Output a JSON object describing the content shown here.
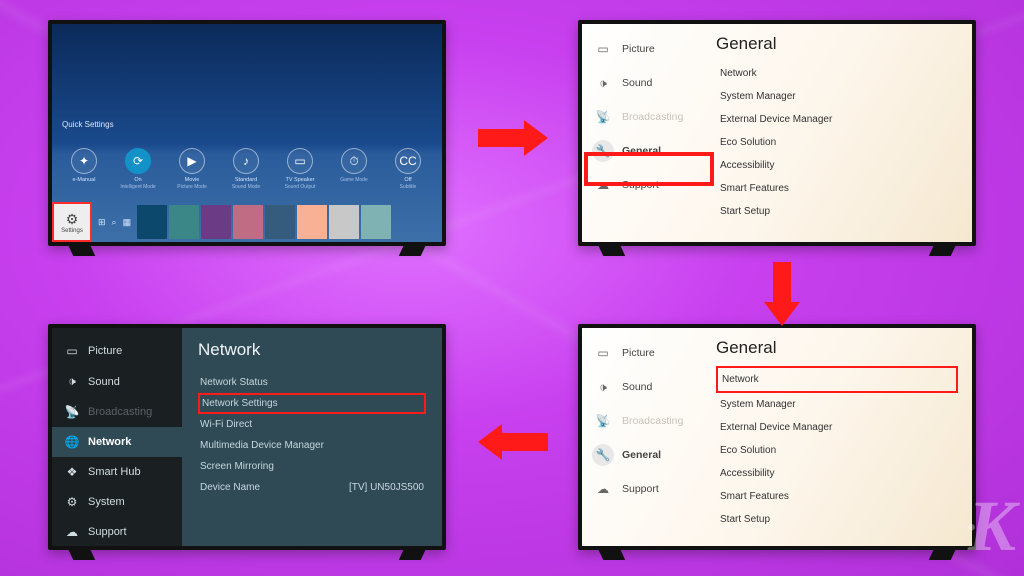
{
  "tv1": {
    "quickSettingsLabel": "Quick Settings",
    "items": [
      {
        "icon": "✦",
        "label": "e-Manual",
        "sub": ""
      },
      {
        "icon": "⟳",
        "label": "On",
        "sub": "Intelligent Mode",
        "hi": true
      },
      {
        "icon": "▶",
        "label": "Movie",
        "sub": "Picture Mode"
      },
      {
        "icon": "♪",
        "label": "Standard",
        "sub": "Sound Mode"
      },
      {
        "icon": "▭",
        "label": "TV Speaker",
        "sub": "Sound Output"
      },
      {
        "icon": "⏱",
        "label": "",
        "sub": "Game Mode"
      },
      {
        "icon": "CC",
        "label": "Off",
        "sub": "Subtitle"
      }
    ],
    "settingsTile": "Settings"
  },
  "sideCategories": [
    {
      "key": "picture",
      "label": "Picture",
      "icon": "▭"
    },
    {
      "key": "sound",
      "label": "Sound",
      "icon": "🕩"
    },
    {
      "key": "broadcasting",
      "label": "Broadcasting",
      "icon": "📡",
      "muted": true
    },
    {
      "key": "general",
      "label": "General",
      "icon": "🔧"
    },
    {
      "key": "support",
      "label": "Support",
      "icon": "☁"
    }
  ],
  "generalPanel": {
    "title": "General",
    "options": [
      "Network",
      "System Manager",
      "External Device Manager",
      "Eco Solution",
      "Accessibility",
      "Smart Features",
      "Start Setup"
    ]
  },
  "tv4": {
    "side": [
      {
        "label": "Picture",
        "icon": "▭"
      },
      {
        "label": "Sound",
        "icon": "🕩"
      },
      {
        "label": "Broadcasting",
        "icon": "📡",
        "muted": true
      },
      {
        "label": "Network",
        "icon": "🌐",
        "active": true
      },
      {
        "label": "Smart Hub",
        "icon": "❖"
      },
      {
        "label": "System",
        "icon": "⚙"
      },
      {
        "label": "Support",
        "icon": "☁"
      }
    ],
    "title": "Network",
    "options": [
      {
        "label": "Network Status"
      },
      {
        "label": "Network Settings",
        "hl": true
      },
      {
        "label": "Wi-Fi Direct"
      },
      {
        "label": "Multimedia Device Manager"
      },
      {
        "label": "Screen Mirroring"
      },
      {
        "label": "Device Name",
        "value": "[TV] UN50JS500"
      }
    ]
  },
  "watermark": "K"
}
